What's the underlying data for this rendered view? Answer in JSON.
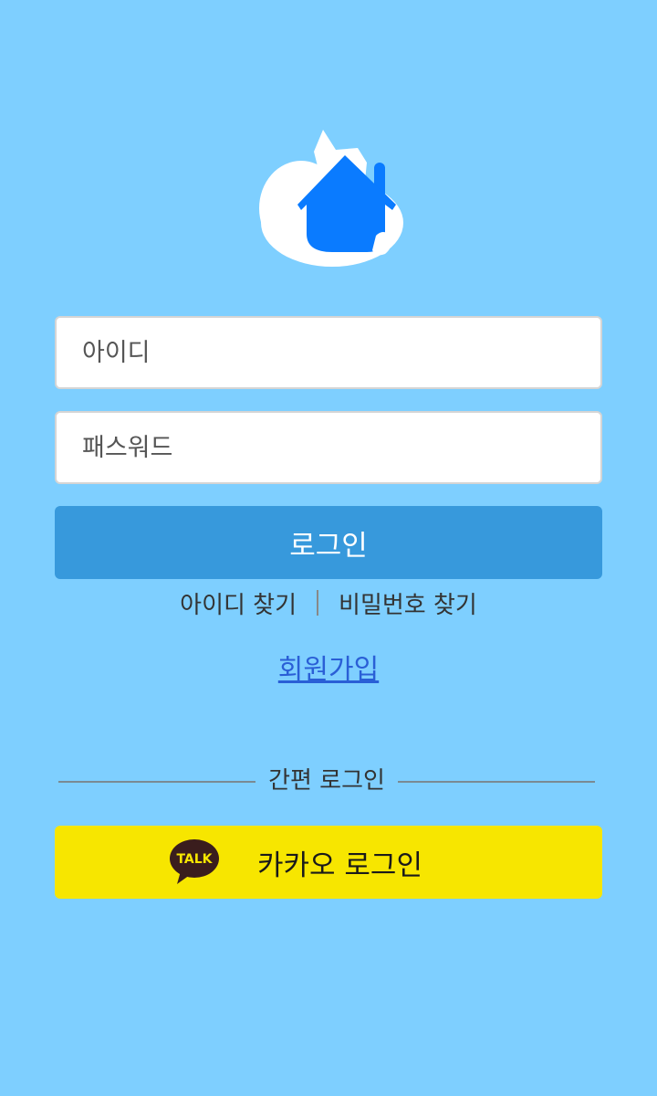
{
  "logo": {
    "name": "house-logo",
    "colors": {
      "bubble": "#ffffff",
      "house": "#0a7bff"
    }
  },
  "login_form": {
    "id_placeholder": "아이디",
    "password_placeholder": "패스워드",
    "login_label": "로그인"
  },
  "links": {
    "find_id": "아이디 찾기",
    "find_password": "비밀번호 찾기",
    "signup": "회원가입"
  },
  "easy_login": {
    "title": "간편 로그인",
    "kakao_label": "카카오 로그인",
    "kakao_badge": "TALK"
  },
  "colors": {
    "background": "#7ecfff",
    "login_button": "#3799dc",
    "kakao_button": "#f7e600",
    "signup_link": "#2a5fd6"
  }
}
